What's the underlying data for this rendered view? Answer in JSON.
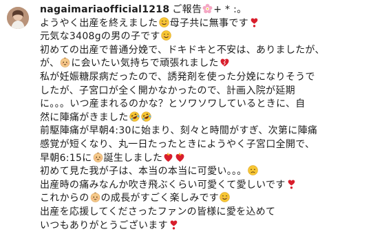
{
  "post": {
    "username": "nagaimariaofficial1218",
    "lines": [
      [
        {
          "t": "ご報告"
        },
        {
          "icon": "flower-icon"
        },
        {
          "t": "+ * :。"
        }
      ],
      [
        {
          "t": "ようやく出産を終えました"
        },
        {
          "icon": "smiling-face-icon"
        },
        {
          "t": "母子共に無事です"
        },
        {
          "icon": "heart-exclamation-icon"
        }
      ],
      [
        {
          "t": "元気な3408gの男の子です"
        },
        {
          "icon": "smiling-face-icon"
        }
      ],
      [
        {
          "t": "初めての出産で普通分娩で、ドキドキと不安は、ありましたが、"
        }
      ],
      [
        {
          "t": "が、"
        },
        {
          "icon": "baby-face-icon"
        },
        {
          "t": "に会いたい気持ちで頑張れました"
        },
        {
          "icon": "mending-heart-icon"
        }
      ],
      [
        {
          "t": "私が妊娠糖尿病だったので、誘発剤を使った分娩になりそうで"
        }
      ],
      [
        {
          "t": "したが、子宮口が全く開かなかったので、計画入院が延期"
        }
      ],
      [
        {
          "t": "に。。。いつ産まれるのかな？とソワソワしているときに、自"
        }
      ],
      [
        {
          "t": "然に陣痛がきました"
        },
        {
          "icon": "rofl-face-icon"
        },
        {
          "icon": "rofl-face-icon"
        }
      ],
      [
        {
          "t": "前駆陣痛が早朝4:30に始まり、刻々と時間がすぎ、次第に陣痛"
        }
      ],
      [
        {
          "t": "感覚が短くなり、丸一日たったときにようやく子宮口全開で、"
        }
      ],
      [
        {
          "t": "早朝6:15に"
        },
        {
          "icon": "baby-face-icon"
        },
        {
          "t": "誕生しました"
        },
        {
          "icon": "heart-on-fire-icon"
        },
        {
          "icon": "heart-on-fire-icon"
        }
      ],
      [
        {
          "t": "初めて見た我が子は、本当の本当に可愛い。。。"
        },
        {
          "icon": "sad-face-icon"
        }
      ],
      [
        {
          "t": "出産時の痛みなんか吹き飛ぶくらい可愛くて愛しいです"
        },
        {
          "icon": "heart-exclamation-icon"
        }
      ],
      [
        {
          "t": "これからの"
        },
        {
          "icon": "baby-face-icon"
        },
        {
          "t": "の成長がすごく楽しみです"
        },
        {
          "icon": "smiling-face-icon"
        }
      ],
      [
        {
          "t": "出産を応援してくださったファンの皆様に愛を込めて"
        }
      ],
      [
        {
          "t": "いつもありがとうございます"
        },
        {
          "icon": "heart-exclamation-icon"
        }
      ]
    ]
  },
  "colors": {
    "text": "#1c1c1c",
    "background": "#ffffff",
    "heart_red": "#d81e2c",
    "emoji_yellow": "#f7c634"
  }
}
